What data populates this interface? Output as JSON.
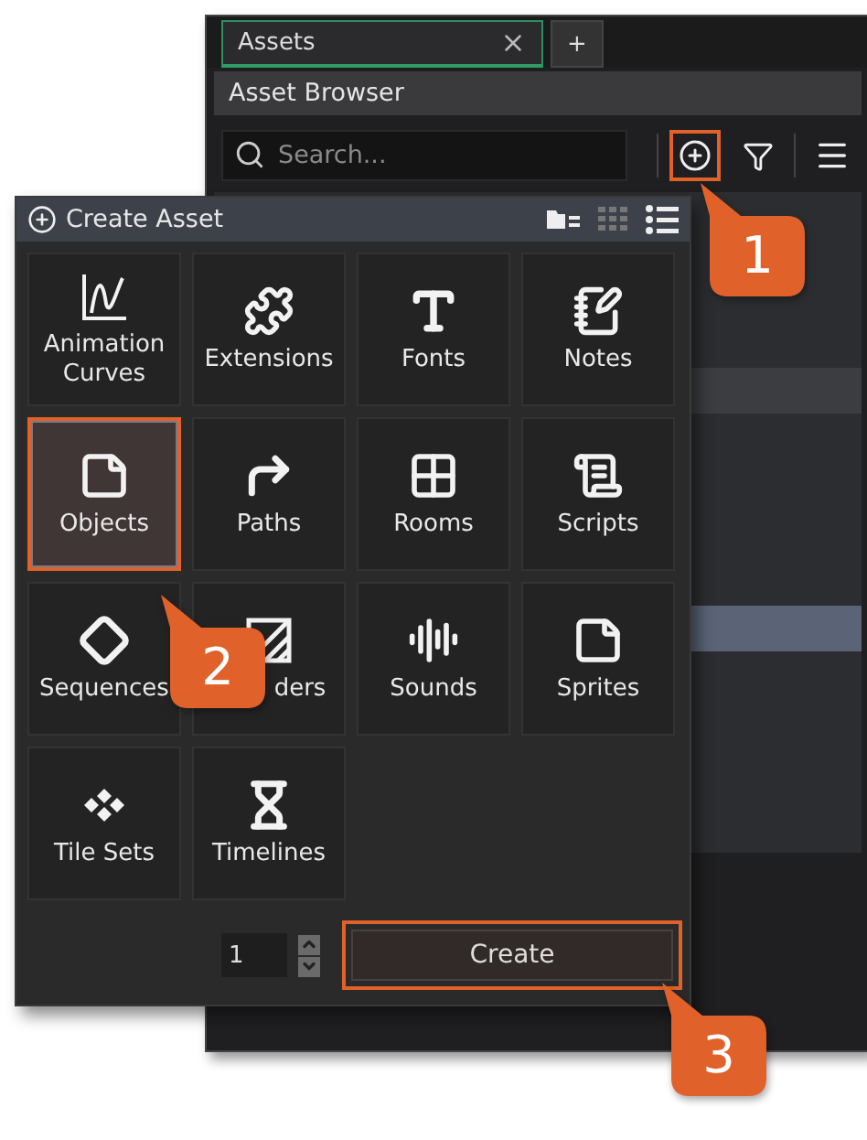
{
  "tabs": [
    {
      "label": "Assets",
      "selected": true,
      "closable": true
    },
    {
      "label": "+",
      "selected": false,
      "closable": false
    }
  ],
  "panel_title": "Asset Browser",
  "toolbar": {
    "search": {
      "placeholder": "Search..."
    },
    "add_highlighted": true
  },
  "create_asset": {
    "title": "Create Asset",
    "items": [
      {
        "label": "Animation Curves",
        "kind": "curve",
        "selected": false
      },
      {
        "label": "Extensions",
        "kind": "puzzle",
        "selected": false
      },
      {
        "label": "Fonts",
        "kind": "font",
        "selected": false
      },
      {
        "label": "Notes",
        "kind": "note",
        "selected": false
      },
      {
        "label": "Objects",
        "kind": "object",
        "selected": true
      },
      {
        "label": "Paths",
        "kind": "path",
        "selected": false
      },
      {
        "label": "Rooms",
        "kind": "room",
        "selected": false
      },
      {
        "label": "Scripts",
        "kind": "script",
        "selected": false
      },
      {
        "label": "Sequences",
        "kind": "sequence",
        "selected": false
      },
      {
        "label": "ders",
        "kind": "shader",
        "selected": false
      },
      {
        "label": "Sounds",
        "kind": "sound",
        "selected": false
      },
      {
        "label": "Sprites",
        "kind": "sprite",
        "selected": false
      },
      {
        "label": "Tile Sets",
        "kind": "tileset",
        "selected": false
      },
      {
        "label": "Timelines",
        "kind": "timeline",
        "selected": false
      }
    ],
    "count": "1",
    "create_button": {
      "label": "Create",
      "highlighted": true
    }
  },
  "callouts": [
    {
      "number": "1"
    },
    {
      "number": "2"
    },
    {
      "number": "3"
    }
  ]
}
